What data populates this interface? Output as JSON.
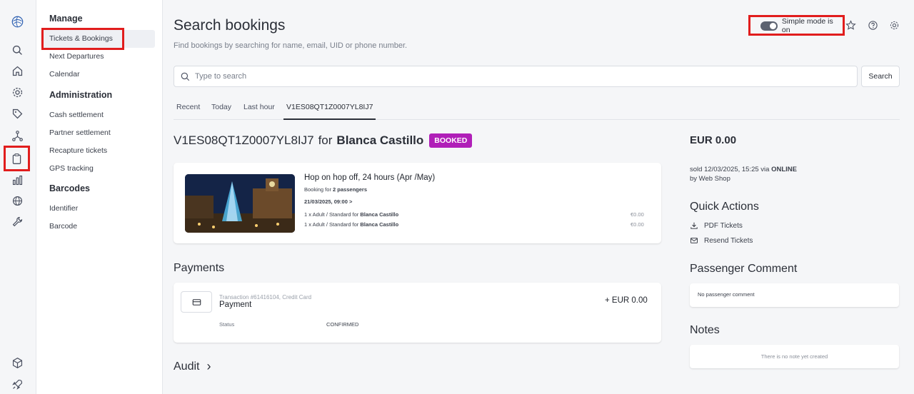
{
  "rail": {
    "icons": [
      "logo-icon",
      "search-icon",
      "home-icon",
      "settings-icon",
      "tag-icon",
      "network-icon",
      "clipboard-icon",
      "bar-chart-icon",
      "globe-icon",
      "wrench-icon",
      "box-icon",
      "rocket-icon"
    ]
  },
  "submenu": {
    "manage": "Manage",
    "manage_items": [
      "Tickets & Bookings",
      "Next Departures",
      "Calendar"
    ],
    "administration": "Administration",
    "admin_items": [
      "Cash settlement",
      "Partner settlement",
      "Recapture tickets",
      "GPS tracking"
    ],
    "barcodes": "Barcodes",
    "barcode_items": [
      "Identifier",
      "Barcode"
    ]
  },
  "header": {
    "title": "Search bookings",
    "subtitle": "Find bookings by searching for name, email, UID or phone number.",
    "simple_mode": "Simple mode is on"
  },
  "search": {
    "placeholder": "Type to search",
    "button": "Search"
  },
  "tabs": [
    "Recent",
    "Today",
    "Last hour",
    "V1ES08QT1Z0007YL8IJ7"
  ],
  "booking": {
    "uid": "V1ES08QT1Z0007YL8IJ7",
    "for": "for",
    "customer": "Blanca Castillo",
    "status": "BOOKED",
    "product": "Hop on hop off,  24 hours (Apr /May)",
    "booking_for_prefix": "Booking for",
    "booking_for": "2 passengers",
    "datetime": "21/03/2025, 09:00 >",
    "passengers": [
      {
        "prefix": "1 x Adult / Standard for",
        "name": "Blanca Castillo",
        "price": "€0.00"
      },
      {
        "prefix": "1 x Adult / Standard for",
        "name": "Blanca Castillo",
        "price": "€0.00"
      }
    ]
  },
  "payments": {
    "title": "Payments",
    "transaction": "Transaction #61416104, Credit Card",
    "name": "Payment",
    "amount": "+ EUR 0.00",
    "status_label": "Status",
    "status_value": "CONFIRMED"
  },
  "audit": {
    "title": "Audit",
    "chevron": "›"
  },
  "summary": {
    "amount": "EUR 0.00",
    "sold_prefix": "sold 12/03/2025, 15:25 via",
    "sold_channel": "ONLINE",
    "sold_by": "by Web Shop"
  },
  "quick_actions": {
    "title": "Quick Actions",
    "items": [
      "PDF Tickets",
      "Resend Tickets"
    ]
  },
  "passenger_comment": {
    "title": "Passenger Comment",
    "text": "No passenger comment"
  },
  "notes": {
    "title": "Notes",
    "text": "There is no note yet created"
  },
  "colors": {
    "accent": "#b01fb8",
    "highlight": "#e11d1d"
  }
}
